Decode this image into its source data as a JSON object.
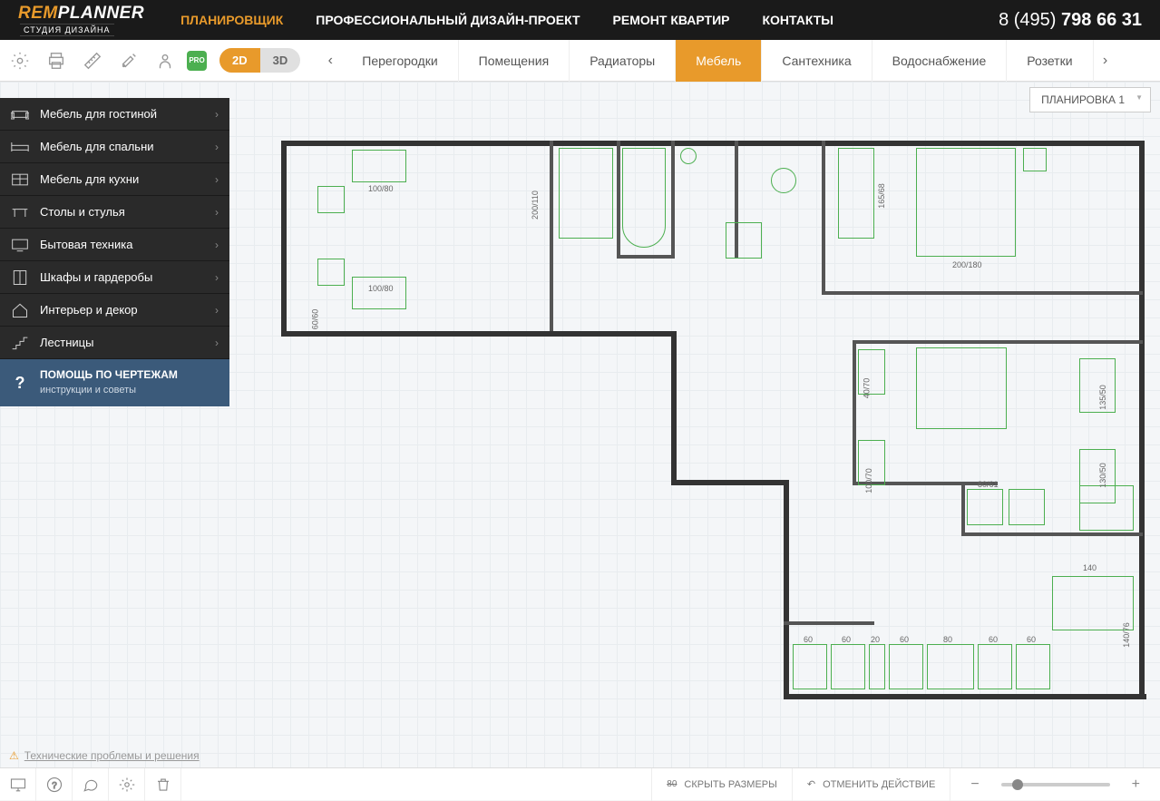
{
  "logo": {
    "brand1": "REM",
    "brand2": "PLANNER",
    "sub": "СТУДИЯ ДИЗАЙНА"
  },
  "nav": [
    {
      "label": "ПЛАНИРОВЩИК",
      "active": true
    },
    {
      "label": "ПРОФЕССИОНАЛЬНЫЙ ДИЗАЙН-ПРОЕКТ",
      "active": false
    },
    {
      "label": "РЕМОНТ КВАРТИР",
      "active": false
    },
    {
      "label": "КОНТАКТЫ",
      "active": false
    }
  ],
  "phone": {
    "prefix": "8 (495) ",
    "number": "798 66 31"
  },
  "pro_badge": "PRO",
  "view": {
    "d2": "2D",
    "d3": "3D"
  },
  "tabs": [
    {
      "label": "Перегородки",
      "active": false
    },
    {
      "label": "Помещения",
      "active": false
    },
    {
      "label": "Радиаторы",
      "active": false
    },
    {
      "label": "Мебель",
      "active": true
    },
    {
      "label": "Сантехника",
      "active": false
    },
    {
      "label": "Водоснабжение",
      "active": false
    },
    {
      "label": "Розетки",
      "active": false
    }
  ],
  "layout_dropdown": "ПЛАНИРОВКА 1",
  "sidebar": {
    "items": [
      {
        "label": "Мебель для гостиной"
      },
      {
        "label": "Мебель для спальни"
      },
      {
        "label": "Мебель для кухни"
      },
      {
        "label": "Столы и стулья"
      },
      {
        "label": "Бытовая техника"
      },
      {
        "label": "Шкафы и гардеробы"
      },
      {
        "label": "Интерьер и декор"
      },
      {
        "label": "Лестницы"
      }
    ],
    "help": {
      "title": "ПОМОЩЬ ПО ЧЕРТЕЖАМ",
      "sub": "инструкции и советы"
    }
  },
  "floorplan_labels": {
    "d1": "100/80",
    "d2": "200/110",
    "d3": "100/80",
    "d4": "60/60",
    "d5": "200/180",
    "d6": "165/68",
    "d7": "40/70",
    "d8": "100/70",
    "d9": "135/50",
    "d10": "130/50",
    "d11": "80/61",
    "d12": "140",
    "d13": "140/76",
    "d14_60": "60",
    "d14_20": "20",
    "d14_80": "80"
  },
  "tech_link": "Технические проблемы и решения",
  "bottom": {
    "hide_dims": "СКРЫТЬ РАЗМЕРЫ",
    "undo": "ОТМЕНИТЬ ДЕЙСТВИЕ",
    "dim_icon": "80"
  }
}
